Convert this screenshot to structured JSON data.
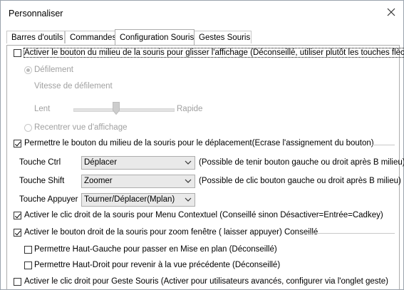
{
  "window": {
    "title": "Personnaliser",
    "close_icon": "close-icon"
  },
  "tabs": [
    {
      "label": "Barres d'outils"
    },
    {
      "label": "Commandes"
    },
    {
      "label": "Configuration Souris"
    },
    {
      "label": "Gestes Souris"
    }
  ],
  "options": {
    "middle_button_pan": {
      "label": "Activer le bouton du milieu de la souris pour glisser l'affichage (Déconseillé, utiliser plutôt les touches flèches)",
      "checked": false
    },
    "scroll_radio": {
      "label": "Défilement",
      "selected": true
    },
    "scroll_speed": {
      "label": "Vitesse de défilement",
      "min_label": "Lent",
      "max_label": "Rapide",
      "value": 0.42
    },
    "recenter_radio": {
      "label": "Recentrer vue d'affichage",
      "selected": false
    },
    "middle_button_move": {
      "label": "Permettre le bouton du milieu de la souris pour le déplacement(Ecrase l'assignement du bouton)",
      "checked": true
    },
    "ctrl_key": {
      "label": "Touche Ctrl",
      "value": "Déplacer",
      "note": "(Possible de tenir bouton gauche ou droit après B milieu)"
    },
    "shift_key": {
      "label": "Touche Shift",
      "value": "Zoomer",
      "note": "(Possible de clic bouton gauche ou droit après B milieu)"
    },
    "press_key": {
      "label": "Touche Appuyer",
      "value": "Tourner/Déplacer(Mplan)"
    },
    "right_click_menu": {
      "label": "Activer le clic droit de la souris pour Menu Contextuel (Conseillé sinon Désactiver=Entrée=Cadkey)",
      "checked": true
    },
    "right_button_zoom": {
      "label": "Activer le bouton droit de la souris pour zoom fenêtre ( laisser appuyer) Conseillé",
      "checked": true
    },
    "top_left_plan": {
      "label": "Permettre Haut-Gauche pour passer en Mise en plan (Déconseillé)",
      "checked": false
    },
    "top_right_prev": {
      "label": "Permettre Haut-Droit pour revenir à la vue précédente (Déconseillé)",
      "checked": false
    },
    "right_click_gesture": {
      "label": "Activer le clic droit pour Geste Souris (Activer pour utilisateurs avancés, configurer via l'onglet geste)",
      "checked": false
    }
  }
}
